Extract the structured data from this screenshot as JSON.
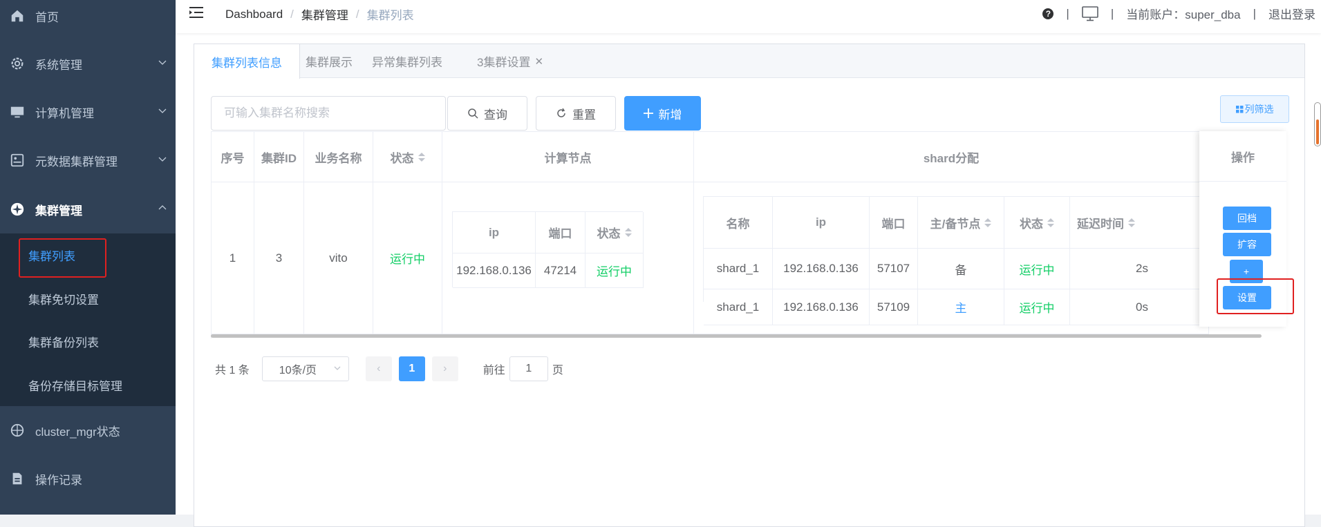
{
  "sidebar": {
    "items": [
      {
        "label": "首页",
        "icon": "home-icon"
      },
      {
        "label": "系统管理",
        "icon": "gear-icon"
      },
      {
        "label": "计算机管理",
        "icon": "monitor-icon"
      },
      {
        "label": "元数据集群管理",
        "icon": "database-icon"
      },
      {
        "label": "集群管理",
        "icon": "cluster-icon"
      },
      {
        "label": "cluster_mgr状态",
        "icon": "compass-icon"
      },
      {
        "label": "操作记录",
        "icon": "document-icon"
      }
    ],
    "submenu": [
      "集群列表",
      "集群免切设置",
      "集群备份列表",
      "备份存储目标管理"
    ]
  },
  "navbar": {
    "breadcrumb": [
      "Dashboard",
      "集群管理",
      "集群列表"
    ],
    "account": "当前账户：super_dba",
    "logout": "退出登录"
  },
  "tabs": [
    "集群列表信息",
    "集群展示",
    "异常集群列表",
    "3集群设置"
  ],
  "toolbar": {
    "search_placeholder": "可输入集群名称搜索",
    "query": "查询",
    "reset": "重置",
    "add": "新增",
    "column_filter": "列筛选"
  },
  "table": {
    "headers": {
      "seq": "序号",
      "cluster_id": "集群ID",
      "biz_name": "业务名称",
      "status": "状态",
      "compute": "计算节点",
      "shard": "shard分配",
      "ops": "操作"
    },
    "row": {
      "seq": "1",
      "cluster_id": "3",
      "biz_name": "vito",
      "status": "运行中"
    },
    "compute_headers": [
      "ip",
      "端口",
      "状态"
    ],
    "compute_row": [
      "192.168.0.136",
      "47214",
      "运行中"
    ],
    "shard_headers": [
      "名称",
      "ip",
      "端口",
      "主/备节点",
      "状态",
      "延迟时间"
    ],
    "shard_rows": [
      [
        "shard_1",
        "192.168.0.136",
        "57107",
        "备",
        "运行中",
        "2s"
      ],
      [
        "shard_1",
        "192.168.0.136",
        "57109",
        "主",
        "运行中",
        "0s"
      ]
    ],
    "ops_buttons": [
      "回档",
      "扩容",
      "+",
      "设置"
    ]
  },
  "pagination": {
    "total": "共 1 条",
    "page_size": "10条/页",
    "current": "1",
    "goto_label": "前往",
    "goto_value": "1",
    "page_unit": "页"
  },
  "colors": {
    "sidebar": "#304156",
    "submenu": "#1f2d3d",
    "primary": "#409eff",
    "running": "#13ce66",
    "highlight": "#e02020"
  }
}
